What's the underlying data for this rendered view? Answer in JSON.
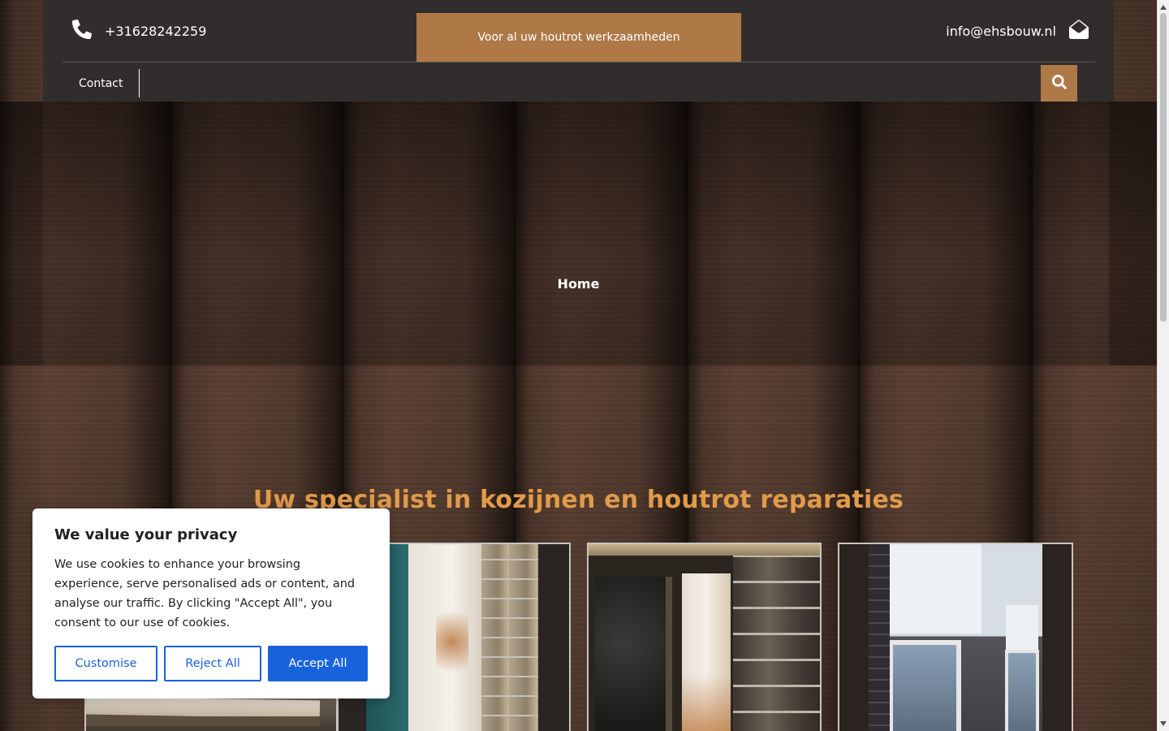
{
  "header": {
    "phone": "+31628242259",
    "tagline": "Voor al uw houtrot werkzaamheden",
    "email": "info@ehsbouw.nl",
    "nav": {
      "contact_label": "Contact"
    }
  },
  "hero": {
    "title": "Home"
  },
  "section": {
    "heading": "Uw specialist in kozijnen en houtrot reparaties"
  },
  "cookie_banner": {
    "title": "We value your privacy",
    "text": "We use cookies to enhance your browsing experience, serve personalised ads or content, and analyse our traffic. By clicking \"Accept All\", you consent to our use of cookies.",
    "customise_label": "Customise",
    "reject_label": "Reject All",
    "accept_label": "Accept All"
  },
  "colors": {
    "header_bg": "#312d2c",
    "accent": "#ae7947",
    "heading": "#e09a4a",
    "primary_button": "#1863dc"
  },
  "icons": [
    "phone-icon",
    "envelope-icon",
    "search-icon"
  ]
}
